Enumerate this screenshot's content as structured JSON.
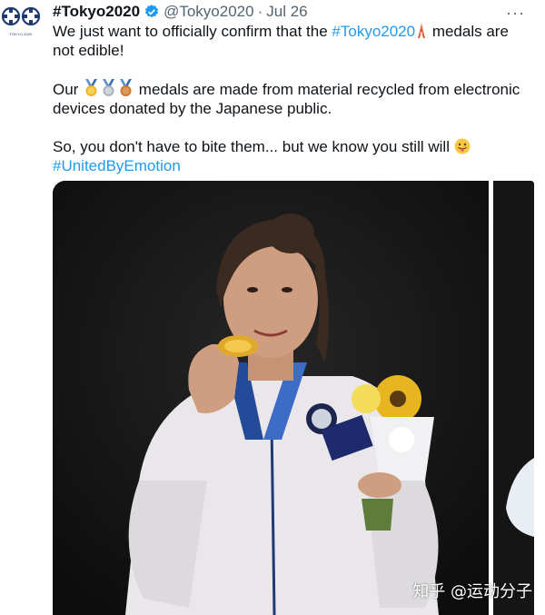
{
  "tweet": {
    "display_name": "#Tokyo2020",
    "handle": "@Tokyo2020",
    "separator": "·",
    "date": "Jul 26",
    "more_icon": "more-dots-icon",
    "verified_icon": "verified-badge-icon",
    "avatar": {
      "caption": "TOKYO 2020"
    },
    "line1_before": "We just want to officially confirm that the ",
    "line1_tag": "#Tokyo2020",
    "line1_after": " medals are not edible!",
    "line2_before": "Our ",
    "line2_after": " medals are made from material recycled from electronic devices donated by the Japanese public.",
    "line3": "So, you don't have to bite them... but we know you still will ",
    "line4_tag": "#UnitedByEmotion"
  },
  "colors": {
    "link": "#1d9bf0",
    "secondary_text": "#536471",
    "verified": "#1d9bf0",
    "emblem_blue": "#1e3a6e"
  },
  "icons": [
    "tokyo-tower-icon",
    "gold-medal-icon",
    "silver-medal-icon",
    "bronze-medal-icon",
    "tongue-out-face-icon"
  ],
  "media": {
    "photos": 2
  },
  "watermark": "知乎 @运动分子"
}
